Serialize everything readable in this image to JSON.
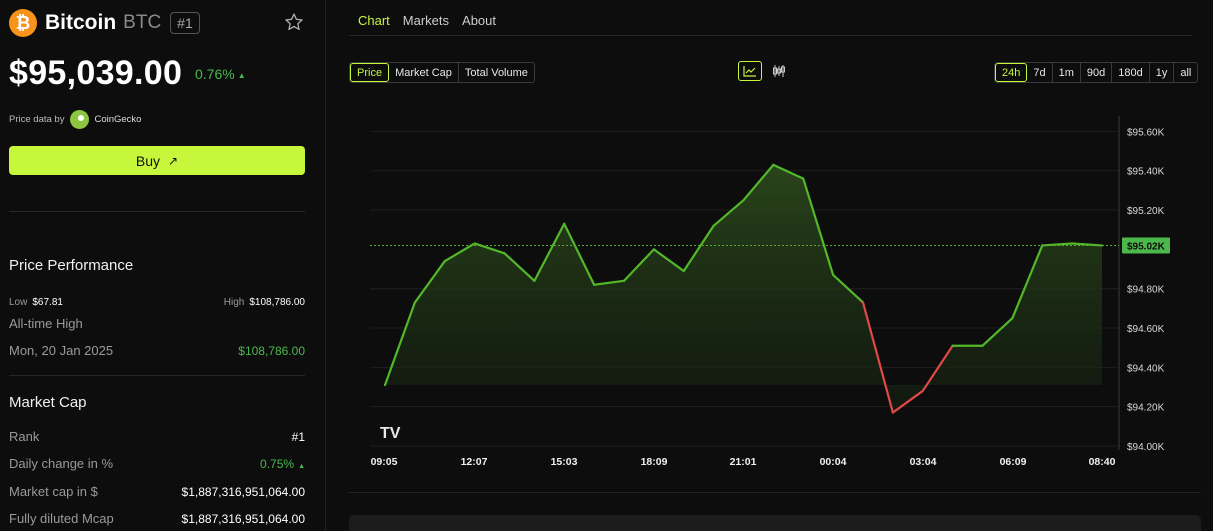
{
  "coin": {
    "logo_glyph": "₿",
    "name": "Bitcoin",
    "symbol": "BTC",
    "rank": "#1"
  },
  "price": {
    "value": "$95,039.00",
    "change": "0.76%",
    "change_arrow": "▲"
  },
  "price_source": {
    "label": "Price data by",
    "provider": "CoinGecko"
  },
  "buy": {
    "label": "Buy",
    "arrow": "↗"
  },
  "performance": {
    "title": "Price Performance",
    "low_label": "Low",
    "low_value": "$67.81",
    "high_label": "High",
    "high_value": "$108,786.00",
    "ath_label": "All-time High",
    "ath_date": "Mon, 20 Jan 2025",
    "ath_value": "$108,786.00"
  },
  "market_cap": {
    "title": "Market Cap",
    "rank_label": "Rank",
    "rank_value": "#1",
    "daily_label": "Daily change in %",
    "daily_value": "0.75%",
    "daily_arrow": "▲",
    "mcap_label": "Market cap in $",
    "mcap_value": "$1,887,316,951,064.00",
    "fdv_label": "Fully diluted Mcap",
    "fdv_value": "$1,887,316,951,064.00"
  },
  "tabs": [
    "Chart",
    "Markets",
    "About"
  ],
  "metric_options": [
    "Price",
    "Market Cap",
    "Total Volume"
  ],
  "range_options": [
    "24h",
    "7d",
    "1m",
    "90d",
    "180d",
    "1y",
    "all"
  ],
  "colors": {
    "accent": "#c6f73a",
    "up": "#4cb84c",
    "down": "#e04848",
    "line": "#52b82a"
  },
  "chart_data": {
    "type": "area",
    "x": [
      "09:05",
      "",
      "",
      "",
      "",
      "12:07",
      "",
      "",
      "15:03",
      "",
      "",
      "",
      "18:09",
      "",
      "",
      "21:01",
      "",
      "",
      "",
      "00:04",
      "",
      "",
      "03:04",
      "",
      "",
      "",
      "06:09",
      "",
      "",
      "08:40"
    ],
    "x_tick_labels": [
      "09:05",
      "12:07",
      "15:03",
      "18:09",
      "21:01",
      "00:04",
      "03:04",
      "06:09",
      "08:40"
    ],
    "values": [
      94310,
      94730,
      94940,
      95030,
      94980,
      94840,
      95130,
      94820,
      94840,
      95000,
      94890,
      95120,
      95250,
      95430,
      95360,
      94870,
      94730,
      94170,
      94280,
      94510,
      94510,
      94650,
      95020,
      95030,
      95020
    ],
    "reference_value": 95020,
    "current_label": "$95.02K",
    "y_ticks": [
      "$95.60K",
      "$95.40K",
      "$95.20K",
      "$94.80K",
      "$94.60K",
      "$94.40K",
      "$94.20K",
      "$94.00K"
    ],
    "y_tick_values": [
      95600,
      95400,
      95200,
      94800,
      94600,
      94400,
      94200,
      94000
    ],
    "ylim": [
      94000,
      95700
    ],
    "grid": true,
    "watermark": "TV"
  }
}
